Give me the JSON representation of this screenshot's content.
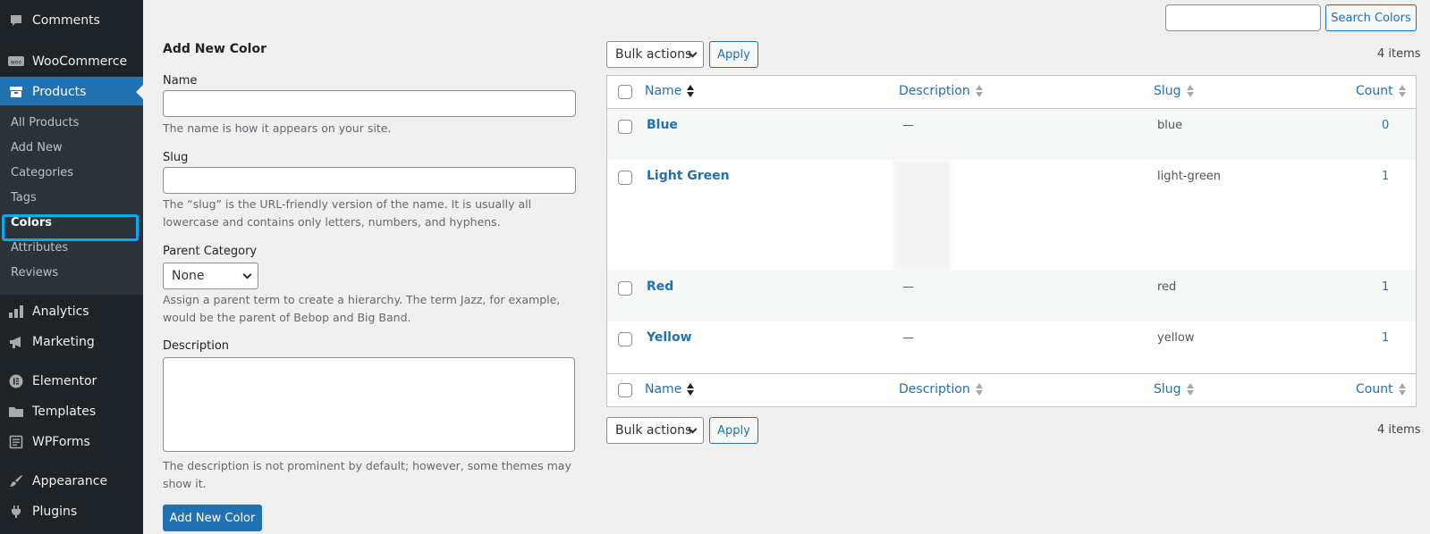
{
  "sidebar": {
    "items": [
      {
        "label": "Comments",
        "icon": "comment-icon"
      },
      {
        "label": "WooCommerce",
        "icon": "woo-icon"
      },
      {
        "label": "Products",
        "icon": "archive-icon"
      },
      {
        "label": "Analytics",
        "icon": "analytics-icon"
      },
      {
        "label": "Marketing",
        "icon": "megaphone-icon"
      },
      {
        "label": "Elementor",
        "icon": "elementor-icon"
      },
      {
        "label": "Templates",
        "icon": "folder-icon"
      },
      {
        "label": "WPForms",
        "icon": "wpforms-icon"
      },
      {
        "label": "Appearance",
        "icon": "paintbrush-icon"
      },
      {
        "label": "Plugins",
        "icon": "plug-icon"
      }
    ],
    "submenu": [
      "All Products",
      "Add New",
      "Categories",
      "Tags",
      "Colors",
      "Attributes",
      "Reviews"
    ],
    "current_submenu": "Colors"
  },
  "search": {
    "value": "",
    "button_label": "Search Colors"
  },
  "form": {
    "heading": "Add New Color",
    "name_label": "Name",
    "name_value": "",
    "name_desc": "The name is how it appears on your site.",
    "slug_label": "Slug",
    "slug_value": "",
    "slug_desc": "The “slug” is the URL-friendly version of the name. It is usually all lowercase and contains only letters, numbers, and hyphens.",
    "parent_label": "Parent Category",
    "parent_value": "None",
    "parent_desc": "Assign a parent term to create a hierarchy. The term Jazz, for example, would be the parent of Bebop and Big Band.",
    "description_label": "Description",
    "description_value": "",
    "description_desc": "The description is not prominent by default; however, some themes may show it.",
    "submit_label": "Add New Color"
  },
  "table": {
    "bulk_actions_label": "Bulk actions",
    "apply_label": "Apply",
    "items_count": "4 items",
    "columns": {
      "name": "Name",
      "description": "Description",
      "slug": "Slug",
      "count": "Count"
    },
    "rows": [
      {
        "name": "Blue",
        "description": "—",
        "slug": "blue",
        "count": "0"
      },
      {
        "name": "Light Green",
        "description": "",
        "slug": "light-green",
        "count": "1"
      },
      {
        "name": "Red",
        "description": "—",
        "slug": "red",
        "count": "1"
      },
      {
        "name": "Yellow",
        "description": "—",
        "slug": "yellow",
        "count": "1"
      }
    ]
  },
  "colors": {
    "sidebar_bg": "#1d2327",
    "accent": "#2271b1",
    "highlight": "#05a9f4"
  }
}
